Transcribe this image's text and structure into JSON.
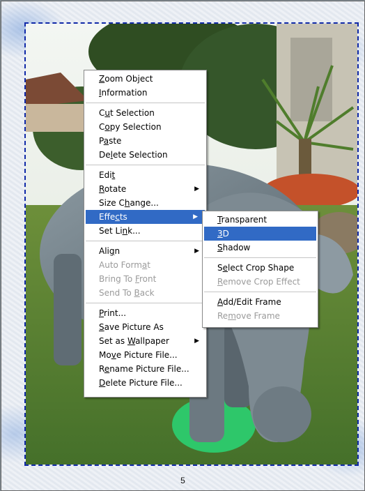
{
  "page_number": "5",
  "menu": [
    {
      "pre": "",
      "u": "Z",
      "post": "oom Object",
      "disabled": false
    },
    {
      "pre": "",
      "u": "I",
      "post": "nformation",
      "disabled": false
    },
    {
      "sep": true
    },
    {
      "pre": "C",
      "u": "u",
      "post": "t Selection",
      "disabled": false
    },
    {
      "pre": "C",
      "u": "o",
      "post": "py Selection",
      "disabled": false
    },
    {
      "pre": "P",
      "u": "a",
      "post": "ste",
      "disabled": false
    },
    {
      "pre": "De",
      "u": "l",
      "post": "ete Selection",
      "disabled": false
    },
    {
      "sep": true
    },
    {
      "pre": "Edi",
      "u": "t",
      "post": "",
      "disabled": false
    },
    {
      "pre": "",
      "u": "R",
      "post": "otate",
      "disabled": false,
      "submenu": true
    },
    {
      "pre": "Size C",
      "u": "h",
      "post": "ange...",
      "disabled": false
    },
    {
      "pre": "Effe",
      "u": "c",
      "post": "ts",
      "disabled": false,
      "submenu": true,
      "selected": true
    },
    {
      "pre": "Set Li",
      "u": "n",
      "post": "k...",
      "disabled": false
    },
    {
      "sep": true
    },
    {
      "pre": "Ali",
      "u": "g",
      "post": "n",
      "disabled": false,
      "submenu": true
    },
    {
      "pre": "Auto Form",
      "u": "a",
      "post": "t",
      "disabled": true
    },
    {
      "pre": "Bring To ",
      "u": "F",
      "post": "ront",
      "disabled": true
    },
    {
      "pre": "Send To ",
      "u": "B",
      "post": "ack",
      "disabled": true
    },
    {
      "sep": true
    },
    {
      "pre": "",
      "u": "P",
      "post": "rint...",
      "disabled": false
    },
    {
      "pre": "",
      "u": "S",
      "post": "ave Picture As",
      "disabled": false
    },
    {
      "pre": "Set as ",
      "u": "W",
      "post": "allpaper",
      "disabled": false,
      "submenu": true
    },
    {
      "pre": "Mo",
      "u": "v",
      "post": "e Picture File...",
      "disabled": false
    },
    {
      "pre": "R",
      "u": "e",
      "post": "name Picture File...",
      "disabled": false
    },
    {
      "pre": "",
      "u": "D",
      "post": "elete Picture File...",
      "disabled": false
    }
  ],
  "submenu": [
    {
      "pre": "",
      "u": "T",
      "post": "ransparent",
      "disabled": false
    },
    {
      "pre": "",
      "u": "3",
      "post": "D",
      "disabled": false,
      "selected": true
    },
    {
      "pre": "",
      "u": "S",
      "post": "hadow",
      "disabled": false
    },
    {
      "sep": true
    },
    {
      "pre": "S",
      "u": "e",
      "post": "lect Crop Shape",
      "disabled": false
    },
    {
      "pre": "",
      "u": "R",
      "post": "emove Crop Effect",
      "disabled": true
    },
    {
      "sep": true
    },
    {
      "pre": "",
      "u": "A",
      "post": "dd/Edit Frame",
      "disabled": false
    },
    {
      "pre": "Re",
      "u": "m",
      "post": "ove Frame",
      "disabled": true
    }
  ]
}
